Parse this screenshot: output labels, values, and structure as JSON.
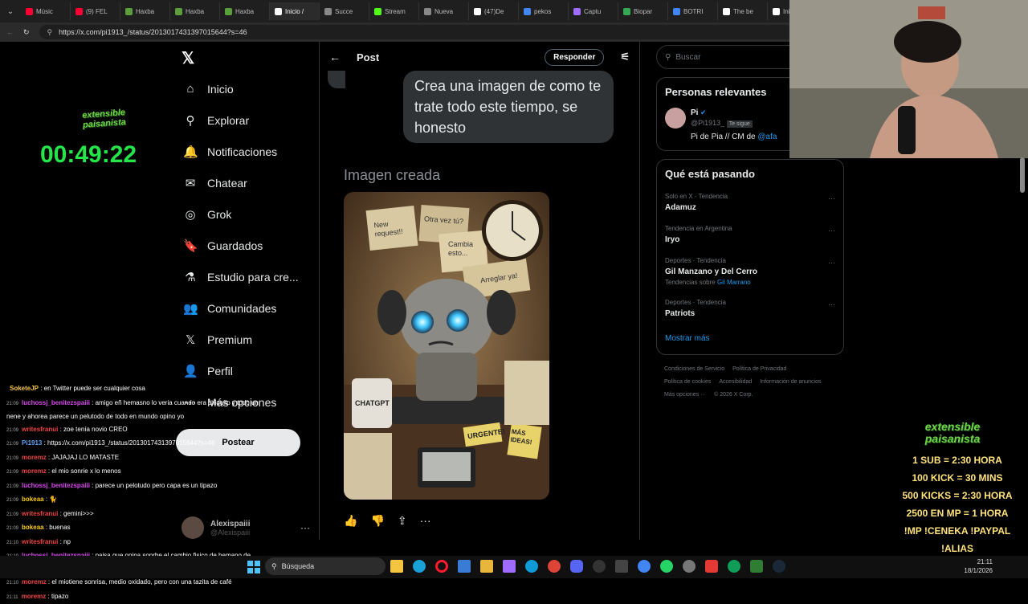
{
  "browser": {
    "tabs": [
      {
        "label": "Músic",
        "color": "#ff0033"
      },
      {
        "label": "(9) FEL",
        "color": "#ff0033"
      },
      {
        "label": "Haxba",
        "color": "#5b9e3c"
      },
      {
        "label": "Haxba",
        "color": "#5b9e3c"
      },
      {
        "label": "Haxba",
        "color": "#5b9e3c"
      },
      {
        "label": "Inicio /",
        "color": "#ffffff"
      },
      {
        "label": "Succe",
        "color": "#888888"
      },
      {
        "label": "Stream",
        "color": "#53fc18"
      },
      {
        "label": "Nueva",
        "color": "#888888"
      },
      {
        "label": "(47)De",
        "color": "#ffffff"
      },
      {
        "label": "pekos",
        "color": "#4285f4"
      },
      {
        "label": "Captu",
        "color": "#a06bff"
      },
      {
        "label": "Biopar",
        "color": "#34a853"
      },
      {
        "label": "BOTRI",
        "color": "#4285f4"
      },
      {
        "label": "The be",
        "color": "#ffffff"
      },
      {
        "label": "Inic",
        "color": "#ffffff"
      }
    ],
    "url": "https://x.com/pi1913_/status/2013017431397015644?s=46"
  },
  "nav": {
    "items": [
      "Inicio",
      "Explorar",
      "Notificaciones",
      "Chatear",
      "Grok",
      "Guardados",
      "Estudio para cre...",
      "Comunidades",
      "Premium",
      "Perfil",
      "Más opciones"
    ],
    "post_button": "Postear",
    "account_name": "Alexispaiii",
    "account_handle": "@Alexispaiii"
  },
  "main": {
    "title": "Post",
    "reply_button": "Responder",
    "bubble_text": "Crea una imagen de como te trate todo este tiempo, se honesto",
    "image_label": "Imagen creada",
    "robot_notes": [
      "New request!!",
      "Otra vez tú?",
      "Cambia esto...",
      "Arreglar ya!",
      "CHATGPT",
      "URGENTE!",
      "MÁS IDEAS!"
    ]
  },
  "right": {
    "search_placeholder": "Buscar",
    "relevant_title": "Personas relevantes",
    "person": {
      "name": "Pi",
      "handle": "@Pi1913_",
      "badge": "Te sigue",
      "bio_text": "Pi de Pia // CM de ",
      "bio_link": "@afa"
    },
    "happening_title": "Qué está pasando",
    "trends": [
      {
        "category": "Solo en X · Tendencia",
        "name": "Adamuz",
        "extra": ""
      },
      {
        "category": "Tendencia en Argentina",
        "name": "Iryo",
        "extra": ""
      },
      {
        "category": "Deportes · Tendencia",
        "name": "Gil Manzano y Del Cerro",
        "extra": "Tendencias sobre ",
        "extra_link": "Gil Marrano"
      },
      {
        "category": "Deportes · Tendencia",
        "name": "Patriots",
        "extra": ""
      }
    ],
    "show_more": "Mostrar más",
    "footer": [
      "Condiciones de Servicio",
      "Política de Privacidad",
      "Política de cookies",
      "Accesibilidad",
      "Información de anuncios",
      "Más opciones ···",
      "© 2026 X Corp."
    ]
  },
  "stream": {
    "brand": "extensible paisanista",
    "timer": "00:49:22",
    "chat": [
      {
        "t": "",
        "user": "SoketeJP",
        "color": "#f5c542",
        "msg": "en Twitter puede ser cualquier cosa"
      },
      {
        "t": "21:09",
        "user": "luchossj_benitezspaiii",
        "color": "#d946ef",
        "msg": "amigo eñ hemasno lo veria cuando era chiquito y todo un nene y ahorea parece un pelutodo de todo en mundo opino yo"
      },
      {
        "t": "21:09",
        "user": "writesfranui",
        "color": "#ef4444",
        "msg": "zoe tenía novio CREO"
      },
      {
        "t": "21:09",
        "user": "Pi1913",
        "color": "#60a5fa",
        "msg": "https://x.com/pi1913_/status/2013017431397015644?s=46"
      },
      {
        "t": "21:09",
        "user": "moremz",
        "color": "#ef4444",
        "msg": "JAJAJAJ LO MATASTE"
      },
      {
        "t": "21:09",
        "user": "moremz",
        "color": "#ef4444",
        "msg": "el mio sonrie x lo menos"
      },
      {
        "t": "21:09",
        "user": "luchossj_benitezspaiii",
        "color": "#d946ef",
        "msg": "parece un pelotudo pero capa es un tipazo"
      },
      {
        "t": "21:09",
        "user": "bokeaa",
        "color": "#facc15",
        "msg": "🐈"
      },
      {
        "t": "21:09",
        "user": "writesfranui",
        "color": "#ef4444",
        "msg": "gemini>>>"
      },
      {
        "t": "21:09",
        "user": "bokeaa",
        "color": "#facc15",
        "msg": "buenas"
      },
      {
        "t": "21:10",
        "user": "writesfranui",
        "color": "#ef4444",
        "msg": "np"
      },
      {
        "t": "21:10",
        "user": "luchossj_benitezspaiii",
        "color": "#d946ef",
        "msg": "paisa que opina soprbe el cambio fisico de hemano de fran ?"
      },
      {
        "t": "21:10",
        "user": "moremz",
        "color": "#ef4444",
        "msg": "el miotiene sonrisa, medio oxidado, pero con una tazita de café"
      },
      {
        "t": "21:11",
        "user": "moremz",
        "color": "#ef4444",
        "msg": "tipazo"
      }
    ],
    "promo": [
      "1 SUB = 2:30 HORA",
      "100 KICK = 30 MINS",
      "500 KICKS = 2:30 HORA",
      "2500 EN MP = 1 HORA",
      "!MP !CENEKA !PAYPAL !ALIAS"
    ]
  },
  "taskbar": {
    "search": "Búsqueda",
    "time": "21:11",
    "date": "18/1/2026"
  }
}
